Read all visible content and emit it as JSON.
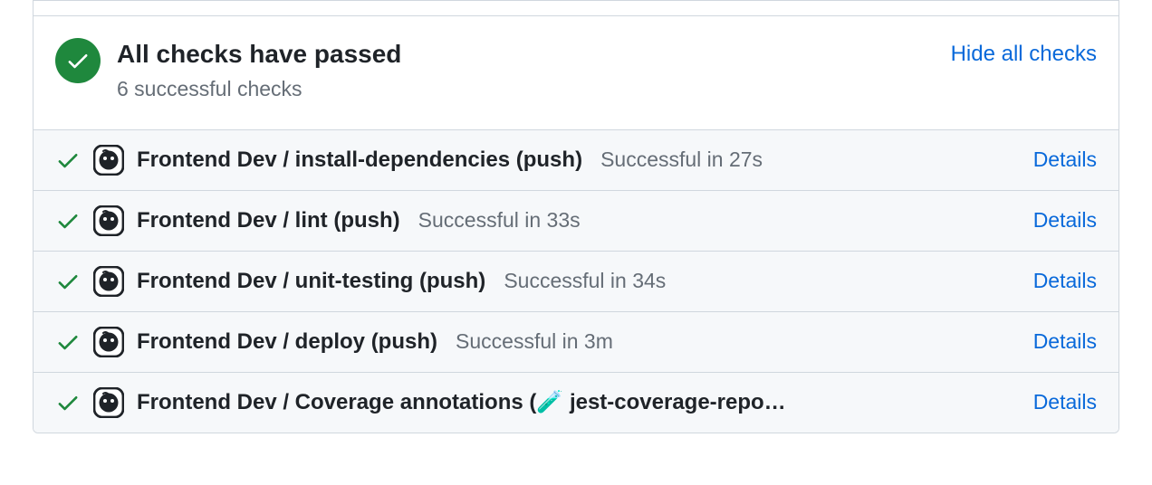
{
  "header": {
    "title": "All checks have passed",
    "subtitle": "6 successful checks",
    "hide_link": "Hide all checks"
  },
  "checks": [
    {
      "name": "Frontend Dev / install-dependencies (push)",
      "duration": "Successful in 27s",
      "details": "Details"
    },
    {
      "name": "Frontend Dev / lint (push)",
      "duration": "Successful in 33s",
      "details": "Details"
    },
    {
      "name": "Frontend Dev / unit-testing (push)",
      "duration": "Successful in 34s",
      "details": "Details"
    },
    {
      "name": "Frontend Dev / deploy (push)",
      "duration": "Successful in 3m",
      "details": "Details"
    },
    {
      "name": "Frontend Dev / Coverage annotations (🧪 jest-coverage-repo…",
      "duration": "",
      "details": "Details"
    }
  ]
}
